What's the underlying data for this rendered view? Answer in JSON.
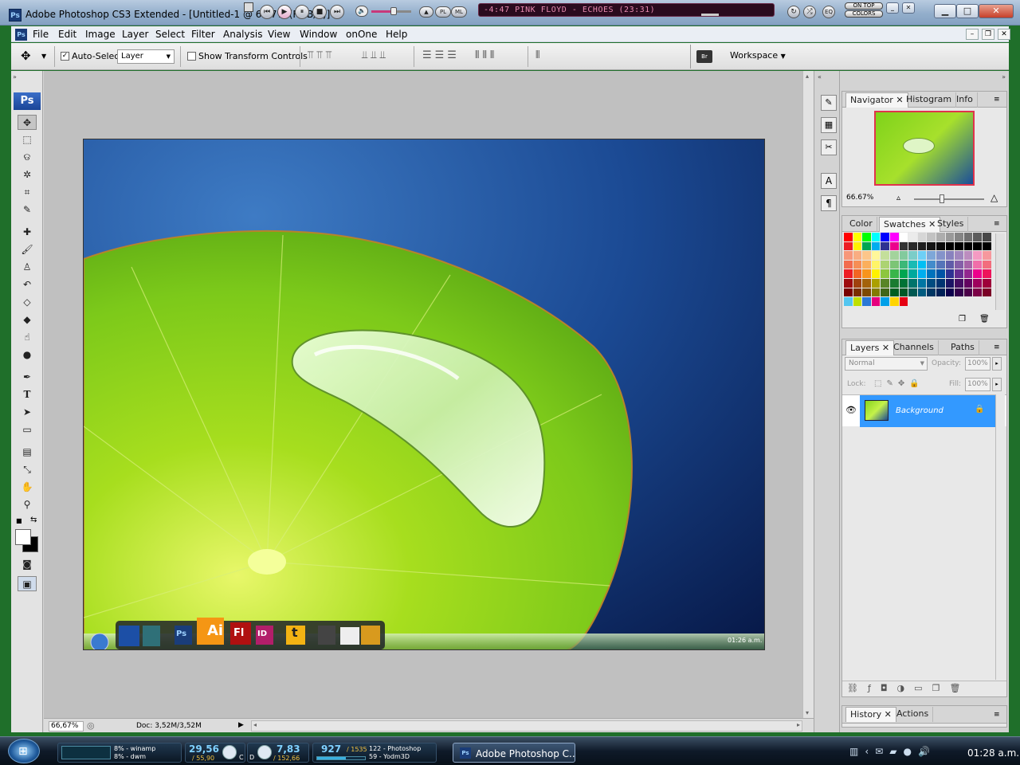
{
  "window": {
    "title": "Adobe Photoshop CS3 Extended - [Untitled-1 @ 66,7% (RGB/8)]",
    "app_icon": "Ps"
  },
  "player": {
    "track": "-4:47  PINK FLOYD - ECHOES (23:31)",
    "buttons": [
      "prev",
      "play",
      "pause",
      "stop",
      "next"
    ],
    "toggles": [
      "ON TOP",
      "COLORS"
    ],
    "pl_label": "PL",
    "ml_label": "ML"
  },
  "window_controls": {
    "minimize": "▁",
    "maximize": "□",
    "close": "✕"
  },
  "menubar": {
    "icon": "Ps",
    "items": [
      "File",
      "Edit",
      "Image",
      "Layer",
      "Select",
      "Filter",
      "Analysis",
      "View",
      "Window",
      "onOne",
      "Help"
    ]
  },
  "options": {
    "auto_select_label": "Auto-Select:",
    "auto_select_checked": true,
    "auto_select_value": "Layer",
    "show_transform_label": "Show Transform Controls",
    "show_transform_checked": false,
    "workspace_label": "Workspace"
  },
  "toolbox": {
    "logo": "Ps",
    "tools": [
      "move-tool",
      "marquee-tool",
      "lasso-tool",
      "magic-wand-tool",
      "crop-tool",
      "slice-tool",
      "healing-brush-tool",
      "brush-tool",
      "clone-stamp-tool",
      "history-brush-tool",
      "eraser-tool",
      "paint-bucket-tool",
      "blur-tool",
      "dodge-tool",
      "pen-tool",
      "type-tool",
      "path-selection-tool",
      "shape-tool",
      "notes-tool",
      "eyedropper-tool",
      "hand-tool",
      "zoom-tool"
    ],
    "type_glyph": "T"
  },
  "document": {
    "desktop_dock": [
      "Ai",
      "Fl",
      "ID",
      "t",
      "Ps"
    ],
    "desktop_clock": "01:26 a.m."
  },
  "statusbar": {
    "zoom": "66,67%",
    "doc_info": "Doc: 3,52M/3,52M"
  },
  "dock_icons": {
    "text_glyph": "A",
    "para_glyph": "¶"
  },
  "navigator": {
    "tabs": [
      "Navigator",
      "Histogram",
      "Info"
    ],
    "zoom": "66.67%"
  },
  "color_panel": {
    "tabs": [
      "Color",
      "Swatches",
      "Styles"
    ]
  },
  "layers_panel": {
    "tabs": [
      "Layers",
      "Channels",
      "Paths"
    ],
    "blend_mode": "Normal",
    "opacity_label": "Opacity:",
    "opacity_value": "100%",
    "lock_label": "Lock:",
    "fill_label": "Fill:",
    "fill_value": "100%",
    "layer_name": "Background"
  },
  "history_panel": {
    "tabs": [
      "History",
      "Actions"
    ]
  },
  "taskbar": {
    "winamp_line1": "8% - winamp",
    "winamp_line2": "8% - dwm",
    "drive_c_value": "29,56",
    "drive_c_total": "/ 55,90",
    "drive_c_label": "C",
    "drive_d_label": "D",
    "drive_d_value": "7,83",
    "drive_d_total": "/ 152,66",
    "mem_value": "927",
    "mem_total": "/ 1535",
    "mem_line1": "122 - Photoshop",
    "mem_line2": "59 - Yodm3D",
    "task_label": "Adobe Photoshop C...",
    "clock": "01:28 a.m."
  },
  "colors": {
    "accent_selection": "#3399ff",
    "track_text": "#e88ab0"
  }
}
